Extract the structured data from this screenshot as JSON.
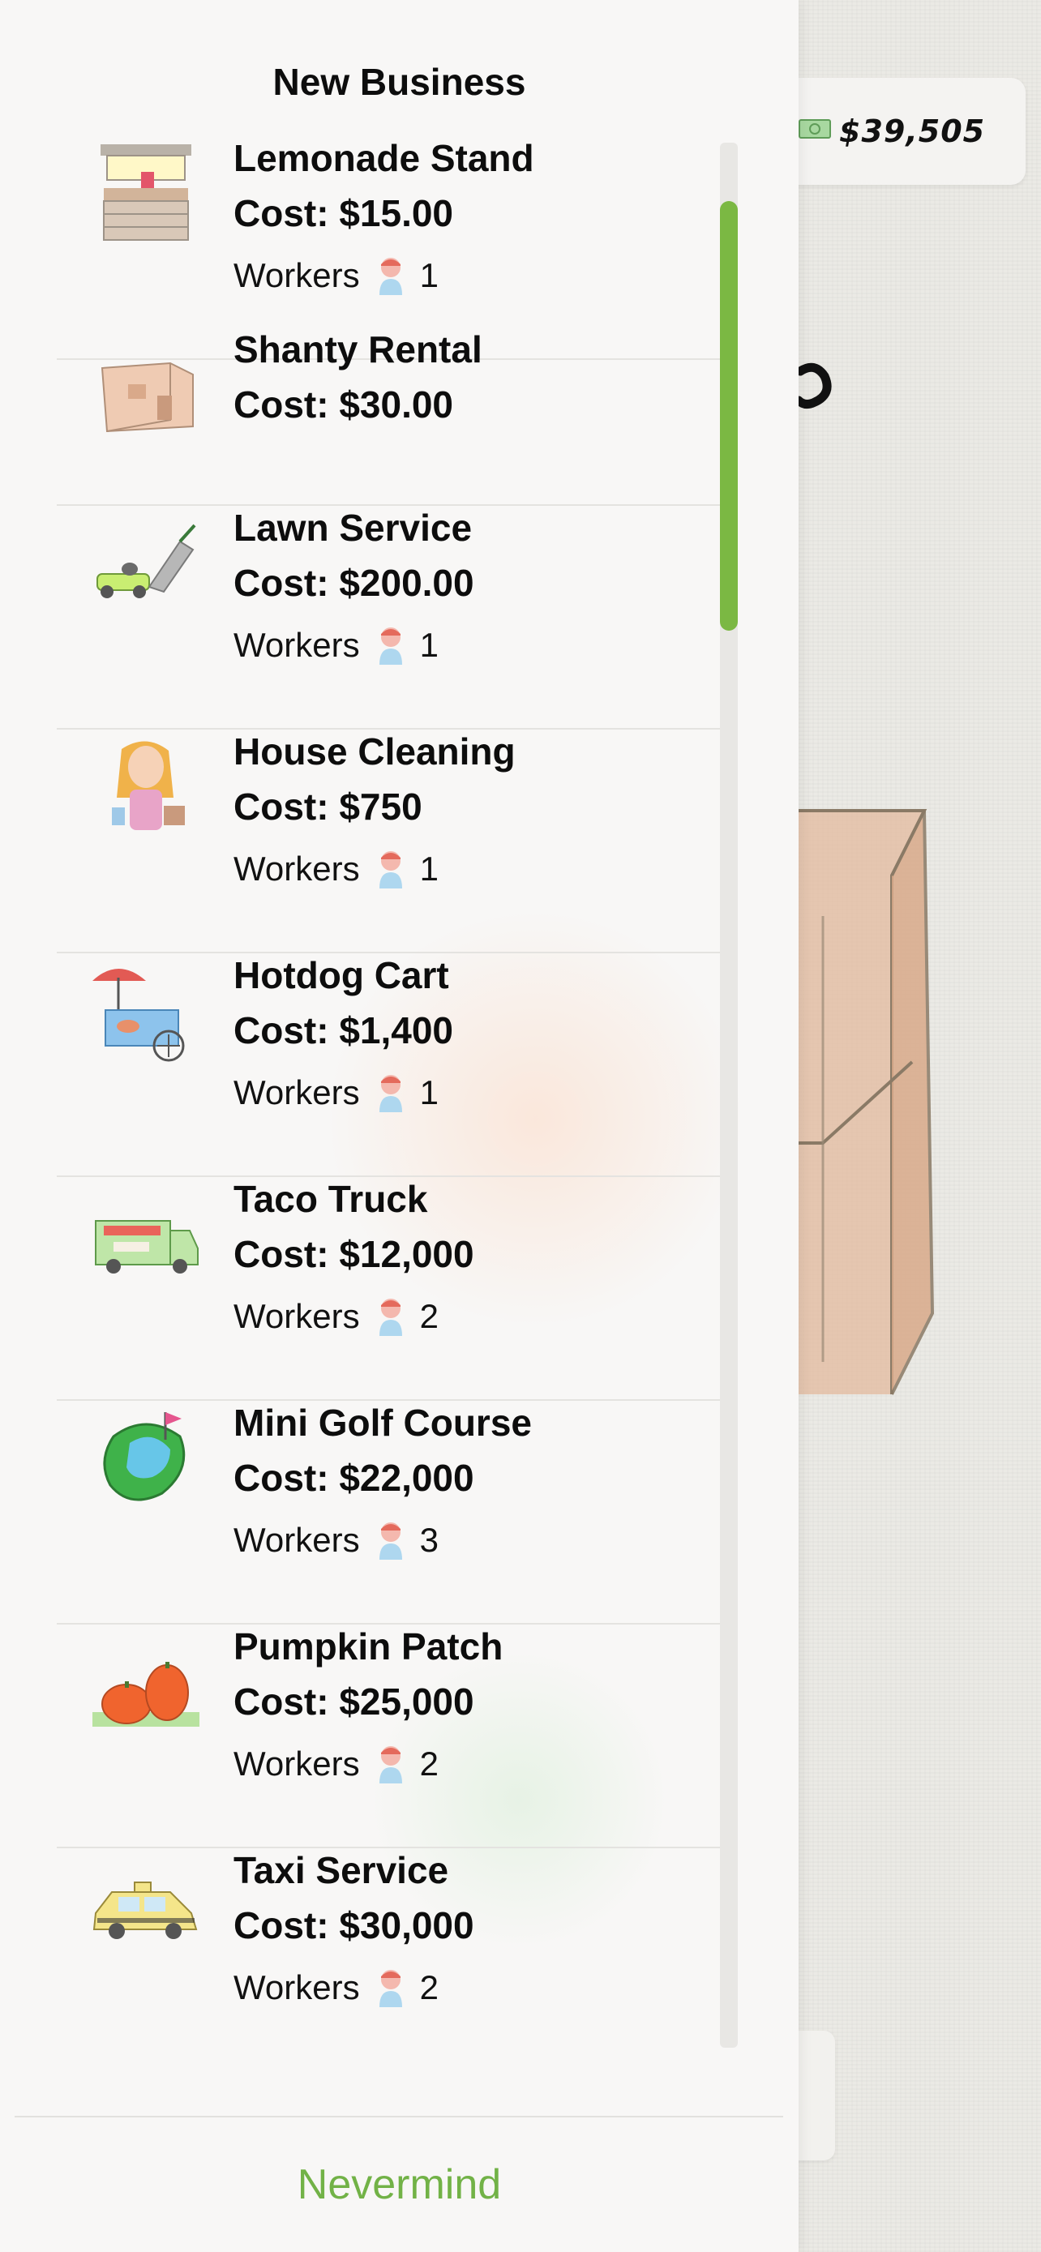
{
  "money": "$39,505",
  "panel": {
    "title": "New Business",
    "nevermind_label": "Nevermind"
  },
  "workers_label": "Workers",
  "businesses": [
    {
      "name": "Lemonade Stand",
      "cost": "Cost: $15.00",
      "workers": "1",
      "icon": "lemonade-stand-icon"
    },
    {
      "name": "Shanty Rental",
      "cost": "Cost: $30.00",
      "workers": null,
      "icon": "shanty-rental-icon"
    },
    {
      "name": "Lawn Service",
      "cost": "Cost: $200.00",
      "workers": "1",
      "icon": "lawn-mower-icon"
    },
    {
      "name": "House Cleaning",
      "cost": "Cost: $750",
      "workers": "1",
      "icon": "house-cleaner-icon"
    },
    {
      "name": "Hotdog Cart",
      "cost": "Cost: $1,400",
      "workers": "1",
      "icon": "hotdog-cart-icon"
    },
    {
      "name": "Taco Truck",
      "cost": "Cost: $12,000",
      "workers": "2",
      "icon": "taco-truck-icon"
    },
    {
      "name": "Mini Golf Course",
      "cost": "Cost: $22,000",
      "workers": "3",
      "icon": "mini-golf-icon"
    },
    {
      "name": "Pumpkin Patch",
      "cost": "Cost: $25,000",
      "workers": "2",
      "icon": "pumpkin-patch-icon"
    },
    {
      "name": "Taxi Service",
      "cost": "Cost: $30,000",
      "workers": "2",
      "icon": "taxi-icon"
    }
  ],
  "colors": {
    "accent_green": "#72b247",
    "scrollbar_green": "#7bb843"
  }
}
